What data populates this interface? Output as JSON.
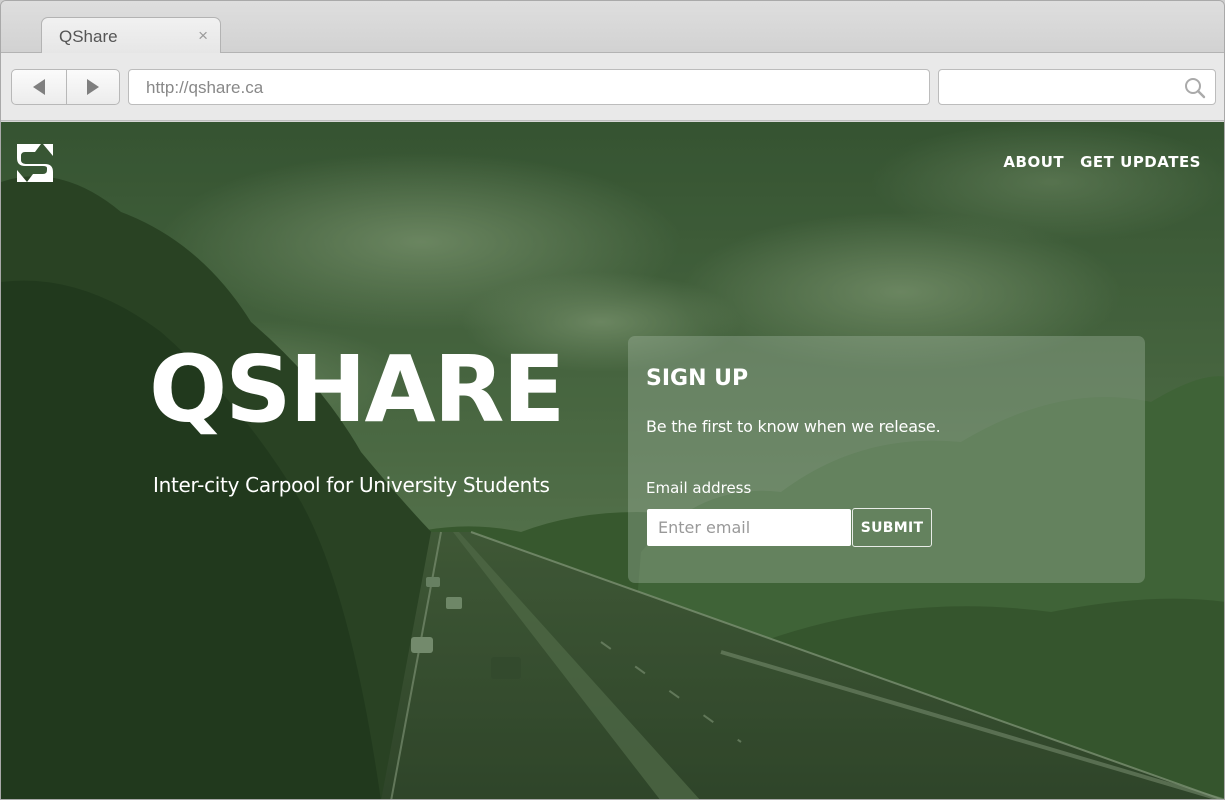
{
  "browser": {
    "tab_title": "QShare",
    "tab_close_glyph": "×",
    "url": "http://qshare.ca",
    "search_value": "",
    "icons": {
      "back": "back-arrow-icon",
      "forward": "forward-arrow-icon",
      "search": "search-icon",
      "close": "close-icon"
    }
  },
  "site": {
    "logo_icon": "qshare-logo-icon",
    "nav": {
      "about": "ABOUT",
      "updates": "GET UPDATES"
    },
    "hero": {
      "title": "QSHARE",
      "subtitle": "Inter-city Carpool for University Students"
    },
    "signup": {
      "title": "SIGN UP",
      "text": "Be the first to know when we release.",
      "email_label": "Email address",
      "email_placeholder": "Enter email",
      "email_value": "",
      "submit_label": "SUBMIT"
    },
    "colors": {
      "overlay_green": "#2f5a2a",
      "text": "#ffffff",
      "panel": "#aabeaa"
    }
  }
}
